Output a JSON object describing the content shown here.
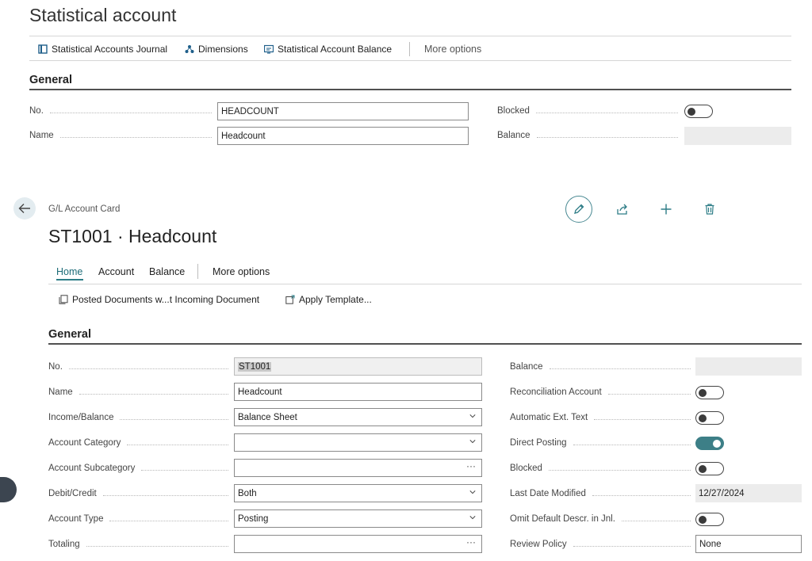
{
  "top": {
    "title": "Statistical account",
    "actions": {
      "journal": "Statistical Accounts Journal",
      "dimensions": "Dimensions",
      "balance": "Statistical Account Balance",
      "more": "More options"
    },
    "section": "General",
    "fields": {
      "no_label": "No.",
      "no_value": "HEADCOUNT",
      "name_label": "Name",
      "name_value": "Headcount",
      "blocked_label": "Blocked",
      "balance_label": "Balance"
    }
  },
  "card": {
    "breadcrumb": "G/L Account Card",
    "title": "ST1001 · Headcount",
    "tabs": {
      "home": "Home",
      "account": "Account",
      "balance": "Balance",
      "more": "More options"
    },
    "actions": {
      "posted_docs": "Posted Documents w...t Incoming Document",
      "apply_template": "Apply Template..."
    },
    "section": "General",
    "left": {
      "no_label": "No.",
      "no_value": "ST1001",
      "name_label": "Name",
      "name_value": "Headcount",
      "income_label": "Income/Balance",
      "income_value": "Balance Sheet",
      "category_label": "Account Category",
      "category_value": "",
      "subcategory_label": "Account Subcategory",
      "subcategory_value": "",
      "debit_label": "Debit/Credit",
      "debit_value": "Both",
      "type_label": "Account Type",
      "type_value": "Posting",
      "totaling_label": "Totaling",
      "totaling_value": ""
    },
    "right": {
      "balance_label": "Balance",
      "recon_label": "Reconciliation Account",
      "autotext_label": "Automatic Ext. Text",
      "direct_label": "Direct Posting",
      "blocked_label": "Blocked",
      "lastmod_label": "Last Date Modified",
      "lastmod_value": "12/27/2024",
      "omit_label": "Omit Default Descr. in Jnl.",
      "review_label": "Review Policy",
      "review_value": "None"
    },
    "toggles": {
      "reconciliation": false,
      "auto_ext_text": false,
      "direct_posting": true,
      "blocked": false,
      "omit_default": false
    }
  },
  "colors": {
    "accent": "#2e7d87",
    "toggle_on": "#3d7f87"
  }
}
